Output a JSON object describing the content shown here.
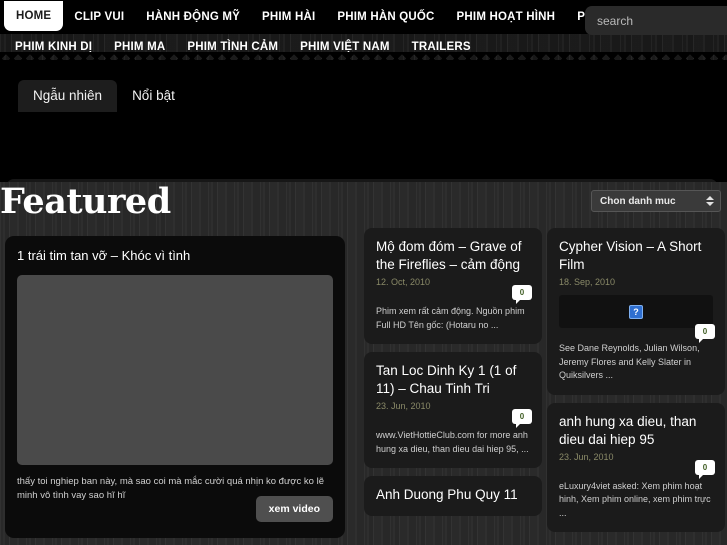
{
  "header": {
    "nav_primary": [
      {
        "label": "HOME",
        "current": true
      },
      {
        "label": "CLIP VUI",
        "current": false
      },
      {
        "label": "HÀNH ĐỘNG MỸ",
        "current": false
      },
      {
        "label": "PHIM HÀI",
        "current": false
      },
      {
        "label": "PHIM HÀN QUỐC",
        "current": false
      },
      {
        "label": "PHIM HOẠT HÌNH",
        "current": false
      },
      {
        "label": "PHIM HONGKONG",
        "current": false
      }
    ],
    "nav_secondary": [
      {
        "label": "PHIM KINH DỊ"
      },
      {
        "label": "PHIM MA"
      },
      {
        "label": "PHIM TÌNH CẢM"
      },
      {
        "label": "PHIM VIỆT NAM"
      },
      {
        "label": "TRAILERS"
      }
    ],
    "search": {
      "placeholder": "search",
      "value": "",
      "submit_icon": "arrow-right-icon"
    }
  },
  "tabs": [
    {
      "label": "Ngẫu nhiên",
      "active": true
    },
    {
      "label": "Nổi bật",
      "active": false
    }
  ],
  "featured_bar": {
    "title": "Featured",
    "category_select": {
      "selected": "Chon danh muc",
      "icon": "spinner-arrows-icon"
    }
  },
  "featured_card": {
    "title": "1 trái tim tan vỡ – Khóc vì tình",
    "excerpt": "thấy toi nghiep ban này, mà sao coi mà mắc cười quá nhịn ko được ko lẽ minh vô tình vay sao hĩ hĩ",
    "button_label": "xem video"
  },
  "cards_mid": [
    {
      "title": "Mộ đom đóm – Grave of the Fireflies – cảm động",
      "date": "12. Oct, 2010",
      "comments": "0",
      "excerpt": "Phim xem rất cảm động. Nguồn phim Full HD Tên gốc:      (Hotaru no ...",
      "has_thumb": false
    },
    {
      "title": "Tan Loc Dinh Ky 1 (1 of 11) – Chau Tinh Tri",
      "date": "23. Jun, 2010",
      "comments": "0",
      "excerpt": "www.VietHottieClub.com for more anh hung xa dieu, than dieu dai hiep 95, ...",
      "has_thumb": false
    },
    {
      "title": "Anh Duong Phu Quy 11",
      "date": "",
      "comments": "",
      "excerpt": "",
      "has_thumb": false,
      "partial": true
    }
  ],
  "cards_right": [
    {
      "title": "Cypher Vision – A Short Film",
      "date": "18. Sep, 2010",
      "comments": "0",
      "excerpt": "See Dane Reynolds, Julian Wilson, Jeremy Flores and Kelly Slater in Quiksilvers ...",
      "has_thumb": true,
      "thumb_icon": "broken-image-icon"
    },
    {
      "title": "anh hung xa dieu, than dieu dai hiep 95",
      "date": "23. Jun, 2010",
      "comments": "0",
      "excerpt": "eLuxury4viet asked: Xem phim hoạt hinh, Xem phim online, xem phim trực ...",
      "has_thumb": false
    }
  ],
  "colors": {
    "page_background": "#000000",
    "header_background": "#1d1d1d",
    "card_background": "#1b1b1b",
    "accent_white": "#ffffff",
    "date_color": "#8a8a68"
  }
}
